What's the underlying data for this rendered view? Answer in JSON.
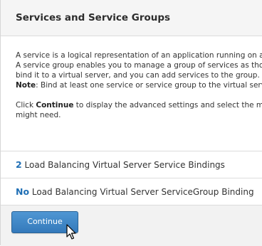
{
  "header": {
    "title": "Services and Service Groups"
  },
  "description": {
    "line1": "A service is a logical representation of an application running on a",
    "line2": "A service group enables you to manage a group of services as tho",
    "line3": "bind it to a virtual server, and you can add services to the group. Y",
    "note_label": "Note",
    "note_text": ": Bind at least one service or service group to the virtual serv",
    "click_prefix": "Click ",
    "click_bold": "Continue",
    "click_suffix": " to display the advanced settings and select the me",
    "line_last": "might need."
  },
  "bindings": [
    {
      "count": "2",
      "label": " Load Balancing Virtual Server Service Bindings"
    },
    {
      "count": "No",
      "label": " Load Balancing Virtual Server ServiceGroup Binding"
    }
  ],
  "footer": {
    "continue_label": "Continue"
  }
}
